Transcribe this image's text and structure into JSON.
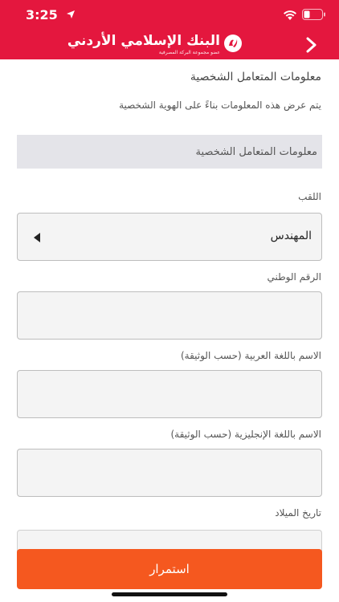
{
  "status_bar": {
    "time": "3:25",
    "icons": [
      "location-arrow-icon",
      "wifi-icon",
      "battery-icon"
    ]
  },
  "header": {
    "logo_name": "البنك الإسلامي الأردني",
    "logo_tagline": "عضو مجموعة البركة المصرفية",
    "back_icon": "chevron-right-icon",
    "colors": {
      "background": "#e4173e",
      "text": "#ffffff"
    }
  },
  "page": {
    "title": "معلومات المتعامل الشخصية",
    "subtitle": "يتم عرض هذه المعلومات بناءً على الهوية الشخصية",
    "section_title": "معلومات المتعامل الشخصية"
  },
  "form": {
    "title_label": "اللقب",
    "title_value": "المهندس",
    "national_id_label": "الرقم الوطني",
    "national_id_value": "",
    "arabic_name_label": "الاسم باللغة العربية (حسب الوثيقة)",
    "arabic_name_value": "",
    "english_name_label": "الاسم باللغة الإنجليزية (حسب الوثيقة)",
    "english_name_value": "",
    "birth_date_label": "تاريخ الميلاد"
  },
  "actions": {
    "continue_label": "استمرار",
    "continue_color": "#f5581f"
  }
}
